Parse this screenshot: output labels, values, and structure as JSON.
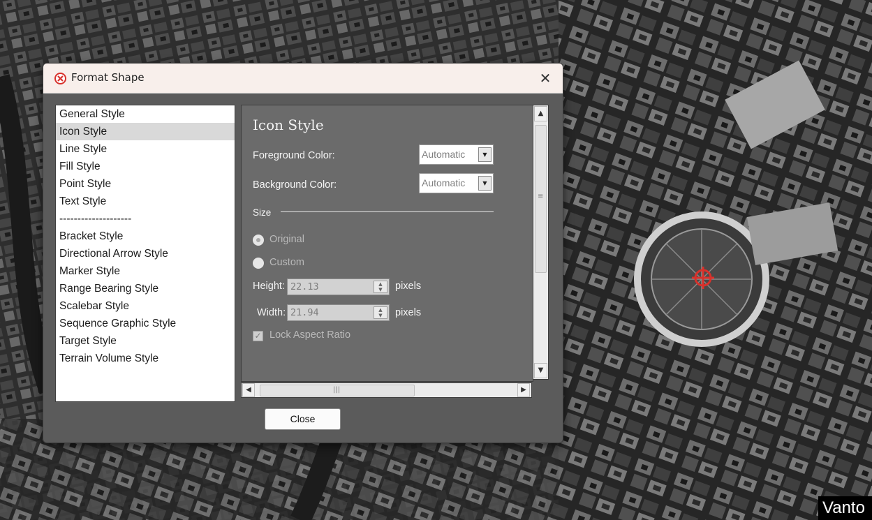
{
  "dialog": {
    "title": "Format Shape",
    "close_glyph": "✕"
  },
  "categories": {
    "selected": "Icon Style",
    "items": [
      "General Style",
      "Icon Style",
      "Line Style",
      "Fill Style",
      "Point Style",
      "Text Style",
      "--------------------",
      "Bracket Style",
      "Directional Arrow Style",
      "Marker Style",
      "Range Bearing Style",
      "Scalebar Style",
      "Sequence Graphic Style",
      "Target Style",
      "Terrain Volume Style"
    ]
  },
  "panel": {
    "heading": "Icon Style",
    "foreground_label": "Foreground Color:",
    "foreground_value": "Automatic",
    "background_label": "Background Color:",
    "background_value": "Automatic",
    "size_section": "Size",
    "radio_original": "Original",
    "radio_custom": "Custom",
    "height_label": "Height:",
    "height_value": "22.13",
    "width_label": "Width:",
    "width_value": "21.94",
    "unit_label": "pixels",
    "lock_label": "Lock Aspect Ratio",
    "lock_checked": true,
    "size_mode": "Original"
  },
  "footer": {
    "close_label": "Close"
  },
  "watermark": "Vanto",
  "colors": {
    "dialog_bg": "#5b5b5b",
    "panel_bg": "#6b6b6b",
    "title_bar": "#f8efeb",
    "icon_red": "#d8312b"
  }
}
